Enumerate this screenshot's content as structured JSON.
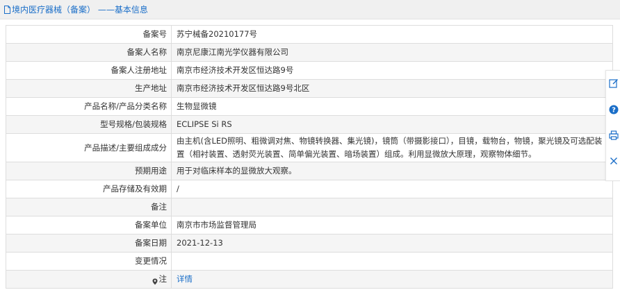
{
  "header": {
    "title": "境内医疗器械（备案） ——基本信息"
  },
  "rows": [
    {
      "label": "备案号",
      "value": "苏宁械备20210177号"
    },
    {
      "label": "备案人名称",
      "value": "南京尼康江南光学仪器有限公司"
    },
    {
      "label": "备案人注册地址",
      "value": "南京市经济技术开发区恒达路9号"
    },
    {
      "label": "生产地址",
      "value": "南京市经济技术开发区恒达路9号北区"
    },
    {
      "label": "产品名称/产品分类名称",
      "value": "生物显微镜"
    },
    {
      "label": "型号规格/包装规格",
      "value": "ECLIPSE Si RS"
    },
    {
      "label": "产品描述/主要组成成分",
      "value": "由主机(含LED照明、粗微调对焦、物镜转换器、集光镜)，镜筒（带摄影接口），目镜，载物台，物镜，聚光镜及可选配装置（相衬装置、透射荧光装置、简单偏光装置、暗场装置）组成。利用显微放大原理，观察物体细节。"
    },
    {
      "label": "预期用途",
      "value": "用于对临床样本的显微放大观察。"
    },
    {
      "label": "产品存储及有效期",
      "value": "/"
    },
    {
      "label": "备注",
      "value": ""
    },
    {
      "label": "备案单位",
      "value": "南京市市场监督管理局"
    },
    {
      "label": "备案日期",
      "value": "2021-12-13"
    },
    {
      "label": "变更情况",
      "value": ""
    },
    {
      "label": "注",
      "value": "详情"
    }
  ],
  "colors": {
    "accent": "#1a6ec8",
    "header_bg": "#f0f0f0",
    "row_alt": "#f5f5f5",
    "border": "#dddddd"
  },
  "side_tools": [
    {
      "icon": "edit-icon"
    },
    {
      "icon": "help-icon"
    },
    {
      "icon": "print-icon"
    },
    {
      "icon": "close-icon"
    }
  ]
}
